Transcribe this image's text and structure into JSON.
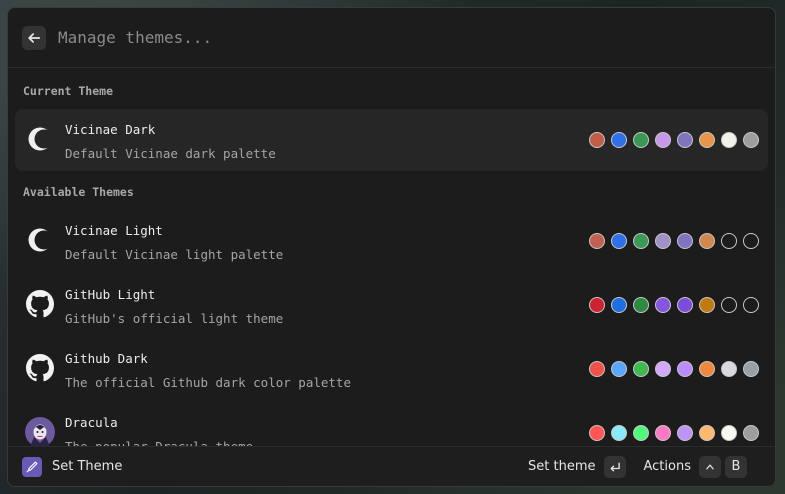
{
  "search": {
    "placeholder": "Manage themes..."
  },
  "sections": {
    "current": "Current Theme",
    "available": "Available Themes"
  },
  "themes": [
    {
      "title": "Vicinae Dark",
      "subtitle": "Default Vicinae dark palette",
      "icon": "moon-icon",
      "swatches": [
        "#c05e48",
        "#2f6fe8",
        "#3a9a55",
        "#c798ea",
        "#7e74c0",
        "#e8944a",
        "#f4f1e8",
        "#9e9e9e"
      ]
    },
    {
      "title": "Vicinae Light",
      "subtitle": "Default Vicinae light palette",
      "icon": "moon-icon",
      "swatches": [
        "#c06251",
        "#2f6fe8",
        "#3a9a55",
        "#a291c8",
        "#7e74c0",
        "#d2874e",
        "#1c1c1c",
        "#1c1c1c"
      ]
    },
    {
      "title": "GitHub Light",
      "subtitle": "GitHub's official light theme",
      "icon": "github-icon",
      "swatches": [
        "#cf2230",
        "#1f6fe0",
        "#2e8a42",
        "#8456e0",
        "#7a4ed8",
        "#c2790e",
        "#1c1c1c",
        "#1c1c1c"
      ]
    },
    {
      "title": "Github Dark",
      "subtitle": "The official Github dark color palette",
      "icon": "github-icon",
      "swatches": [
        "#f0524a",
        "#58a6ff",
        "#3fb950",
        "#d2a8ff",
        "#bc8cff",
        "#f0883e",
        "#d7dadf",
        "#9aa0a6"
      ]
    },
    {
      "title": "Dracula",
      "subtitle": "The popular Dracula theme",
      "icon": "dracula-icon",
      "swatches": [
        "#ff5555",
        "#8be9fd",
        "#50fa7b",
        "#ff79c6",
        "#bd93f9",
        "#ffb86c",
        "#f8f8f2",
        "#9e9e9e"
      ]
    }
  ],
  "footer": {
    "title": "Set Theme",
    "primary_action": "Set theme",
    "actions_label": "Actions",
    "shortcut_key": "B",
    "icon": "brush-icon"
  }
}
